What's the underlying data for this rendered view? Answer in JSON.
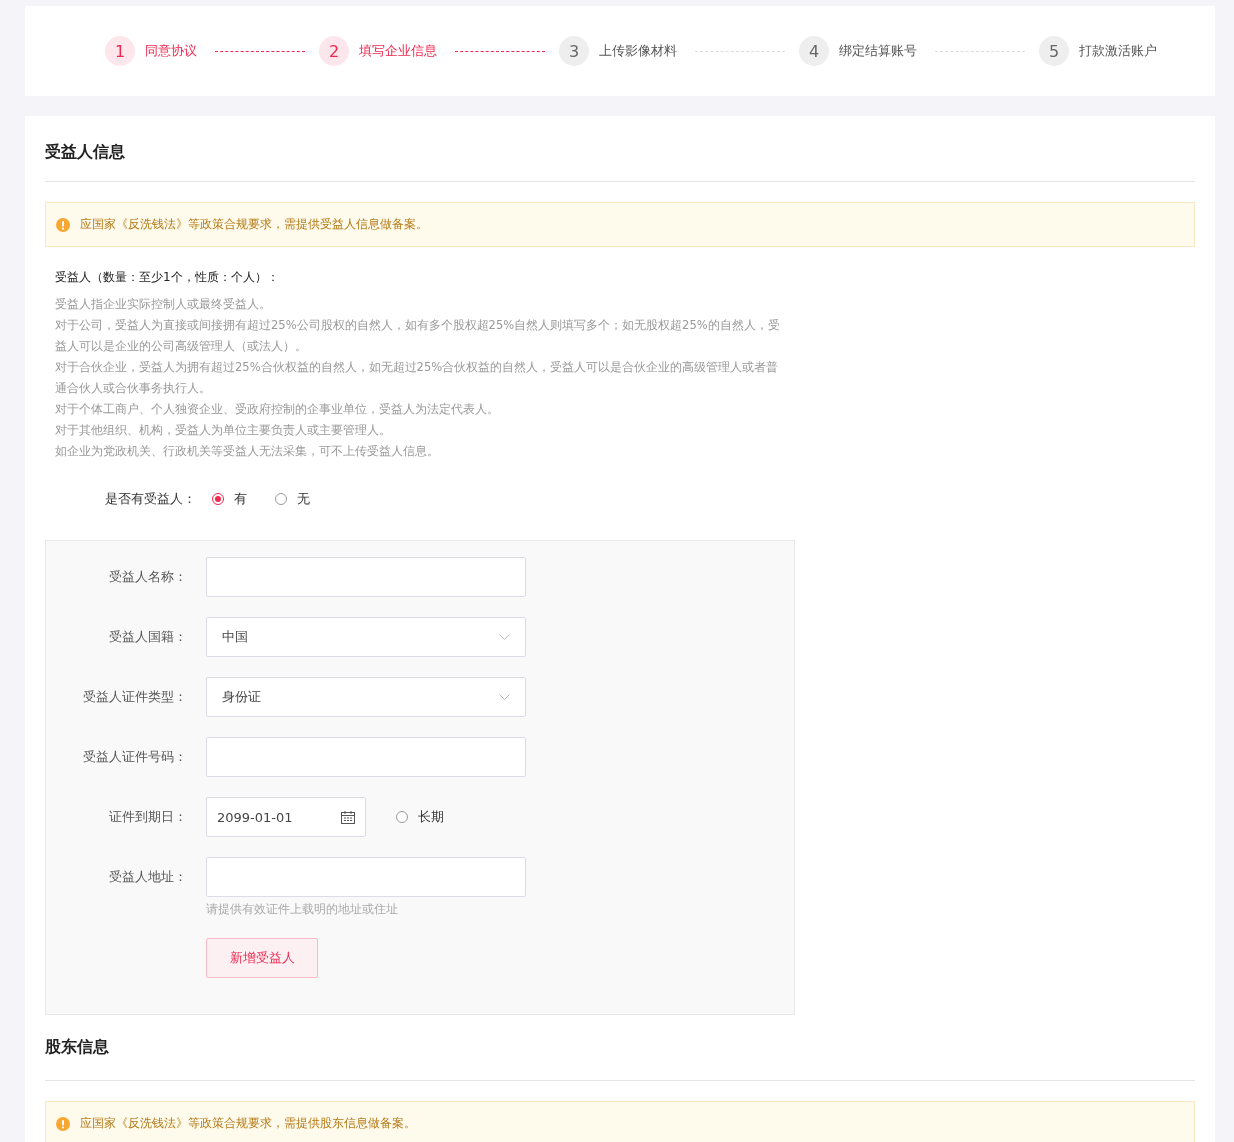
{
  "steps": [
    {
      "number": "1",
      "label": "同意协议",
      "active": true
    },
    {
      "number": "2",
      "label": "填写企业信息",
      "active": true
    },
    {
      "number": "3",
      "label": "上传影像材料",
      "active": false
    },
    {
      "number": "4",
      "label": "绑定结算账号",
      "active": false
    },
    {
      "number": "5",
      "label": "打款激活账户",
      "active": false
    }
  ],
  "beneficiary_section": {
    "title": "受益人信息",
    "notice": "应国家《反洗钱法》等政策合规要求，需提供受益人信息做备案。",
    "heading": "受益人（数量：至少1个，性质：个人）：",
    "description": [
      "受益人指企业实际控制人或最终受益人。",
      "对于公司，受益人为直接或间接拥有超过25%公司股权的自然人，如有多个股权超25%自然人则填写多个；如无股权超25%的自然人，受益人可以是企业的公司高级管理人（或法人）。",
      "对于合伙企业，受益人为拥有超过25%合伙权益的自然人，如无超过25%合伙权益的自然人，受益人可以是合伙企业的高级管理人或者普通合伙人或合伙事务执行人。",
      "对于个体工商户、个人独资企业、受政府控制的企事业单位，受益人为法定代表人。",
      "对于其他组织、机构，受益人为单位主要负责人或主要管理人。",
      "如企业为党政机关、行政机关等受益人无法采集，可不上传受益人信息。"
    ],
    "has_beneficiary": {
      "label": "是否有受益人：",
      "options": [
        {
          "label": "有",
          "selected": true
        },
        {
          "label": "无",
          "selected": false
        }
      ]
    },
    "form": {
      "fields": [
        {
          "label": "受益人名称：",
          "kind": "text"
        },
        {
          "label": "受益人国籍：",
          "kind": "select",
          "value": "中国"
        },
        {
          "label": "受益人证件类型：",
          "kind": "select",
          "value": "身份证"
        },
        {
          "label": "受益人证件号码：",
          "kind": "text"
        },
        {
          "label": "证件到期日：",
          "kind": "date",
          "value": "2099-01-01",
          "option": {
            "label": "长期",
            "checked": false
          }
        },
        {
          "label": "受益人地址：",
          "kind": "text",
          "hint": "请提供有效证件上载明的地址或住址"
        }
      ],
      "add_button": "新增受益人"
    }
  },
  "shareholder_section": {
    "title": "股东信息",
    "notice": "应国家《反洗钱法》等政策合规要求，需提供股东信息做备案。"
  }
}
